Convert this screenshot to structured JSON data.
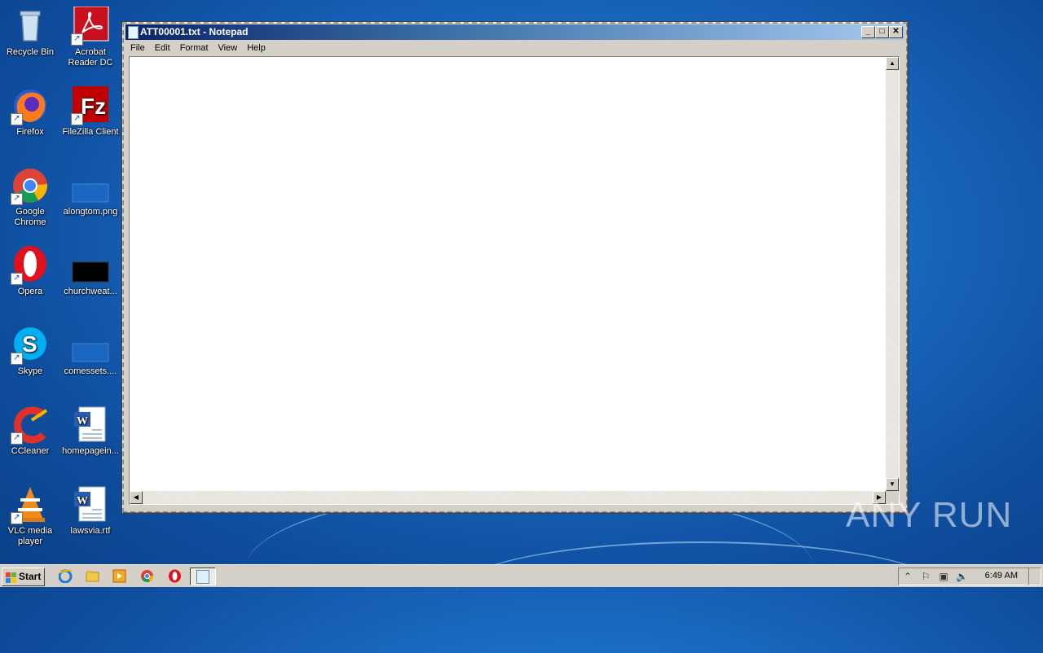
{
  "desktop": {
    "icons": [
      {
        "label": "Recycle Bin",
        "icon": "recycle-bin-icon"
      },
      {
        "label": "Acrobat Reader DC",
        "icon": "acrobat-reader-icon"
      },
      {
        "label": "Firefox",
        "icon": "firefox-icon"
      },
      {
        "label": "FileZilla Client",
        "icon": "filezilla-icon"
      },
      {
        "label": "Google Chrome",
        "icon": "chrome-icon"
      },
      {
        "label": "alongtom.png",
        "icon": "png-file-icon"
      },
      {
        "label": "Opera",
        "icon": "opera-icon"
      },
      {
        "label": "churchweat...",
        "icon": "image-file-icon"
      },
      {
        "label": "Skype",
        "icon": "skype-icon"
      },
      {
        "label": "comessets....",
        "icon": "image-file-icon"
      },
      {
        "label": "CCleaner",
        "icon": "ccleaner-icon"
      },
      {
        "label": "homepagein...",
        "icon": "word-document-icon"
      },
      {
        "label": "VLC media player",
        "icon": "vlc-icon"
      },
      {
        "label": "lawsvia.rtf",
        "icon": "word-document-icon"
      }
    ]
  },
  "window": {
    "title": "ATT00001.txt - Notepad",
    "menu": [
      "File",
      "Edit",
      "Format",
      "View",
      "Help"
    ],
    "content": ""
  },
  "watermark": "ANY RUN",
  "taskbar": {
    "start_label": "Start",
    "quick_launch": [
      "internet-explorer-icon",
      "explorer-folder-icon",
      "media-player-icon",
      "chrome-icon",
      "opera-icon"
    ],
    "active_task": "notepad-icon",
    "clock": "6:49 AM"
  }
}
